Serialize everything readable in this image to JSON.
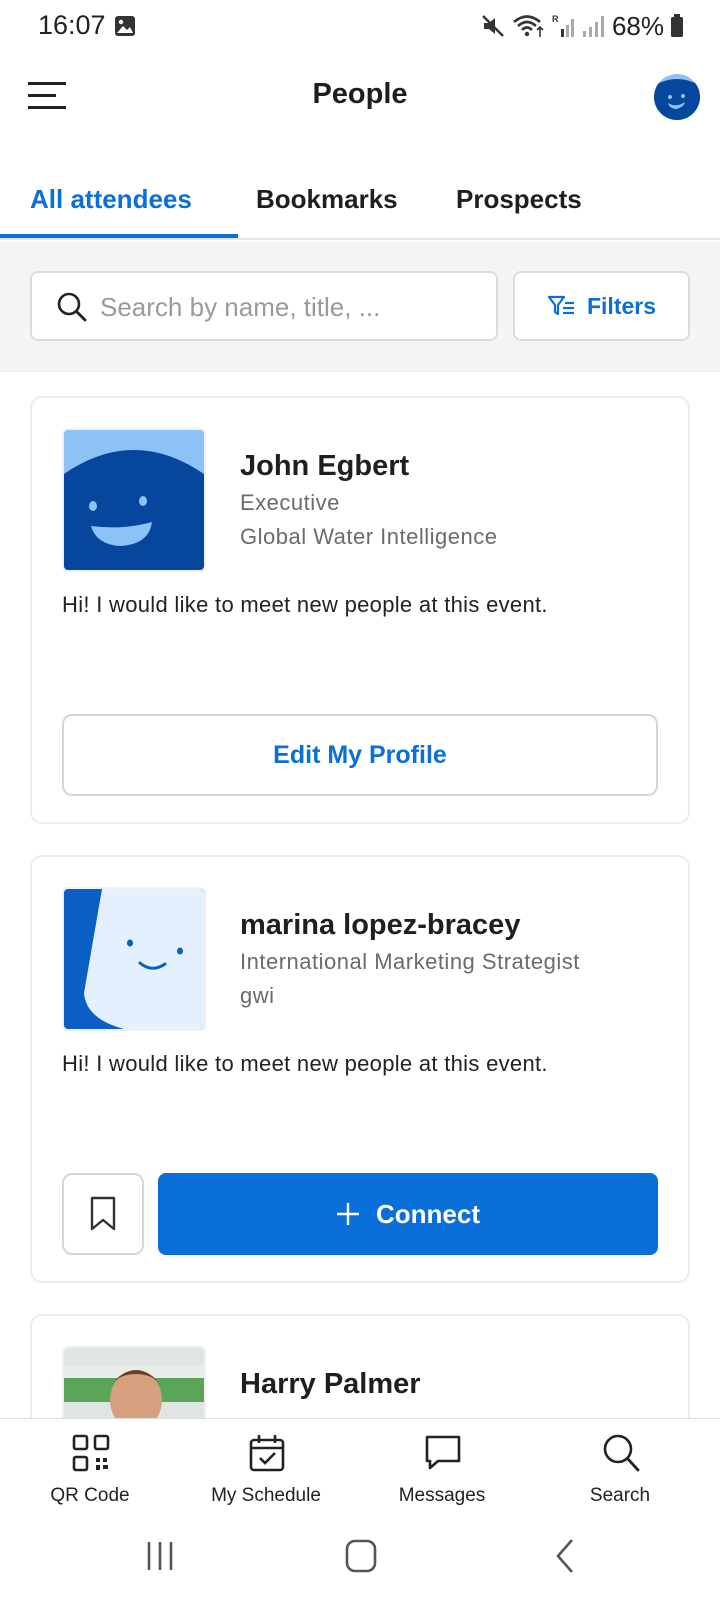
{
  "status_bar": {
    "time": "16:07",
    "battery": "68%"
  },
  "header": {
    "title": "People",
    "menu_icon": "hamburger-menu-icon",
    "avatar_icon": "user-avatar-icon"
  },
  "tabs": [
    {
      "label": "All attendees",
      "active": true
    },
    {
      "label": "Bookmarks",
      "active": false
    },
    {
      "label": "Prospects",
      "active": false
    }
  ],
  "search": {
    "placeholder": "Search by name, title, ...",
    "value": "",
    "filters_label": "Filters"
  },
  "people": [
    {
      "name": "John Egbert",
      "title": "Executive",
      "company": "Global Water Intelligence",
      "bio": "Hi! I would like to meet new people at this event.",
      "action_label": "Edit My Profile"
    },
    {
      "name": "marina lopez-bracey",
      "title": "International Marketing Strategist",
      "company": "gwi",
      "bio": "Hi! I would like to meet new people at this event.",
      "action_label": "Connect"
    },
    {
      "name": "Harry Palmer"
    }
  ],
  "bottom_nav": [
    {
      "label": "QR Code",
      "icon": "qr-code-icon"
    },
    {
      "label": "My Schedule",
      "icon": "calendar-check-icon"
    },
    {
      "label": "Messages",
      "icon": "chat-bubble-icon"
    },
    {
      "label": "Search",
      "icon": "search-icon"
    }
  ],
  "colors": {
    "accent": "#0a6fd8",
    "avatar_dark": "#06469c",
    "avatar_light": "#8cc2f6"
  }
}
